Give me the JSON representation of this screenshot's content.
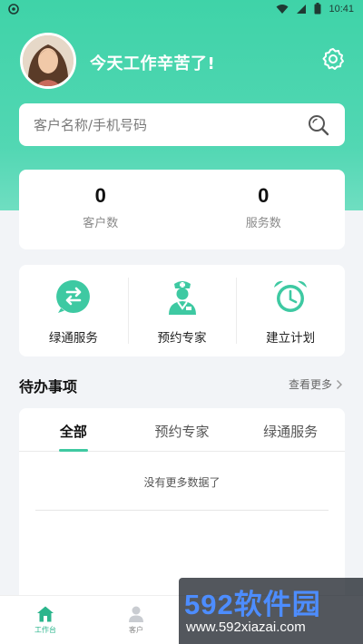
{
  "status_bar": {
    "time": "10:41",
    "icons": [
      "wifi-icon",
      "signal-icon",
      "sim-icon",
      "battery-icon"
    ]
  },
  "header": {
    "greeting": "今天工作辛苦了!"
  },
  "search": {
    "placeholder": "客户名称/手机号码"
  },
  "stats": [
    {
      "value": "0",
      "label": "客户数"
    },
    {
      "value": "0",
      "label": "服务数"
    }
  ],
  "actions": [
    {
      "label": "绿通服务",
      "icon": "swap-arrows-icon"
    },
    {
      "label": "预约专家",
      "icon": "nurse-icon"
    },
    {
      "label": "建立计划",
      "icon": "alarm-clock-icon"
    }
  ],
  "todo": {
    "title": "待办事项",
    "more": "查看更多",
    "tabs": [
      "全部",
      "预约专家",
      "绿通服务"
    ],
    "active_tab": 0,
    "empty_text": "没有更多数据了"
  },
  "bottom_nav": [
    {
      "label": "工作台",
      "icon": "home-icon",
      "active": true
    },
    {
      "label": "客户",
      "icon": "person-icon",
      "active": false
    }
  ],
  "watermark": {
    "brand": "592软件园",
    "url": "www.592xiazai.com"
  },
  "colors": {
    "primary": "#3fd3a8",
    "accent": "#2bb58c",
    "background": "#f2f4f7"
  }
}
